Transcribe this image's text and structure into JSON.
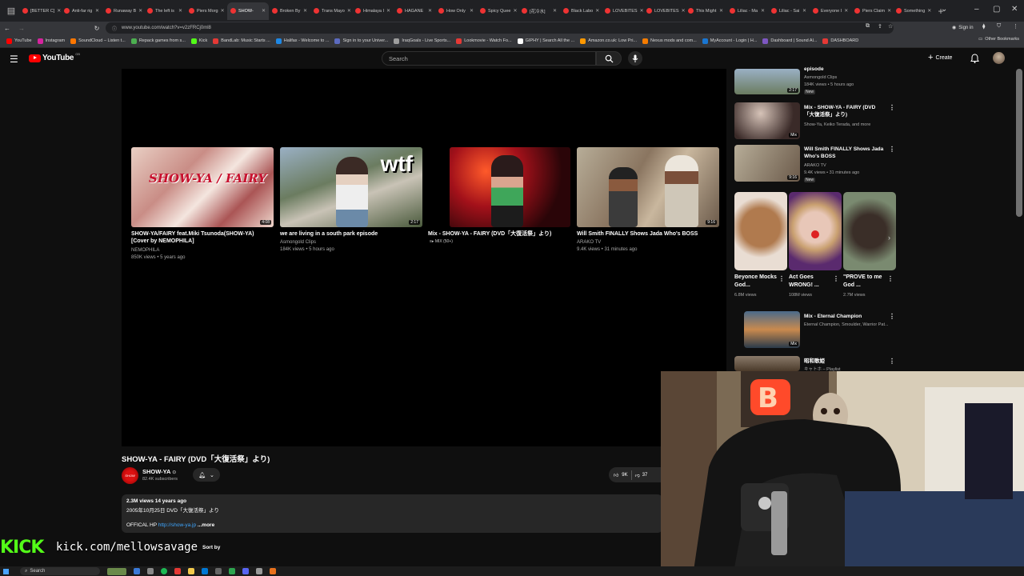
{
  "browser": {
    "tabs": [
      {
        "label": "[BETTER C]",
        "color": "#e33"
      },
      {
        "label": "Anti-far rig",
        "color": "#e33"
      },
      {
        "label": "Runaway B",
        "color": "#e33"
      },
      {
        "label": "The left is",
        "color": "#e33"
      },
      {
        "label": "Piers Morg",
        "color": "#e33"
      },
      {
        "label": "SHOW-",
        "color": "#e33",
        "active": true
      },
      {
        "label": "Broken By",
        "color": "#e33"
      },
      {
        "label": "Trans Mayo",
        "color": "#e33"
      },
      {
        "label": "Himalaya I",
        "color": "#e33"
      },
      {
        "label": "HAGANE",
        "color": "#e33"
      },
      {
        "label": "How Only",
        "color": "#e33"
      },
      {
        "label": "Spicy Quee",
        "color": "#e33"
      },
      {
        "label": "[花冷水]",
        "color": "#e33"
      },
      {
        "label": "Black Labo",
        "color": "#e33"
      },
      {
        "label": "LOVEBITES",
        "color": "#e33"
      },
      {
        "label": "LOVEBITES",
        "color": "#e33"
      },
      {
        "label": "This Might",
        "color": "#e33"
      },
      {
        "label": "Liliac - Ma",
        "color": "#e33"
      },
      {
        "label": "Liliac - Sai",
        "color": "#e33"
      },
      {
        "label": "Everyone I",
        "color": "#e33"
      },
      {
        "label": "Piers Claim",
        "color": "#e33"
      },
      {
        "label": "Something",
        "color": "#e33"
      }
    ],
    "new_tab": "+",
    "url": "www.youtube.com/watch?v=v2zFRCj0ml8",
    "sign_in": "Sign in",
    "bookmarks": [
      {
        "label": "YouTube",
        "color": "#ff0000"
      },
      {
        "label": "Instagram",
        "color": "#d6249f"
      },
      {
        "label": "SoundCloud – Listen t...",
        "color": "#ff7700"
      },
      {
        "label": "Repack games from s...",
        "color": "#4caf50"
      },
      {
        "label": "Kick",
        "color": "#53fc18"
      },
      {
        "label": "BandLab: Music Starts ...",
        "color": "#e53935"
      },
      {
        "label": "Halifax - Welcome to ...",
        "color": "#1e88e5"
      },
      {
        "label": "Sign in to your Univer...",
        "color": "#5c6bc0"
      },
      {
        "label": "IraqGoals - Live Sports...",
        "color": "#9e9e9e"
      },
      {
        "label": "Lookmovie - Watch Fo...",
        "color": "#e53935"
      },
      {
        "label": "GIPHY | Search All the ...",
        "color": "#ffffff"
      },
      {
        "label": "Amazon.co.uk: Low Pri...",
        "color": "#ff9900"
      },
      {
        "label": "Nexus mods and com...",
        "color": "#f57c00"
      },
      {
        "label": "MyAccount - Login | H...",
        "color": "#1976d2"
      },
      {
        "label": "Dashboard | Sound Al...",
        "color": "#7e57c2"
      },
      {
        "label": "DASHBOARD",
        "color": "#e53935"
      }
    ],
    "other_bookmarks": "Other Bookmarks"
  },
  "youtube": {
    "logo_text": "YouTube",
    "country": "GB",
    "search_placeholder": "Search",
    "create_label": "Create"
  },
  "endscreen": [
    {
      "title": "SHOW-YA/FAIRY feat.Miki Tsunoda(SHOW-YA)\n[Cover by NEMOPHILA]",
      "channel": "NEMOPHILA",
      "stats": "850K views • 5 years ago",
      "duration": "4:08",
      "thumb_text": "SHOW-YA / FAIRY"
    },
    {
      "title": "we are living in a south park episode",
      "channel": "Asmongold Clips",
      "stats": "184K views • 5 hours ago",
      "duration": "2:17",
      "thumb_text": "wtf"
    },
    {
      "title": "Mix - SHOW-YA - FAIRY (DVD「大復活祭」より)",
      "channel": "",
      "stats": "",
      "duration": "",
      "mix_badge": "MIX (50+)"
    },
    {
      "title": "Will Smith FINALLY Shows Jada Who's BOSS",
      "channel": "ARAKO TV",
      "stats": "9.4K views • 31 minutes ago",
      "duration": "9:16"
    }
  ],
  "video": {
    "title": "SHOW-YA - FAIRY (DVD「大復活祭」より)",
    "channel": "SHOW-YA",
    "verified": "⊙",
    "subscribers": "82.4K subscribers",
    "likes": "9K",
    "dislikes": "37",
    "desc_stats": "2.3M views  14 years ago",
    "desc_line2": "2005年10月25日 DVD「大復活祭」より",
    "desc_prefix": "OFFICAL HP ",
    "desc_link": "http://show-ya.jp",
    "desc_more": "...more",
    "sort_by": "Sort by"
  },
  "sidebar": {
    "recs": [
      {
        "title": "episode",
        "channel": "Asmongold Clips",
        "stats": "184K views • 5 hours ago",
        "badge": "New",
        "duration": "2:17"
      },
      {
        "title": "Mix - SHOW-YA - FAIRY (DVD「大復活祭」より)",
        "channel": "Show-Ya, Keiko Terada, and more",
        "stats": "",
        "badge": "",
        "duration": "Mix"
      },
      {
        "title": "Will Smith FINALLY Shows Jada Who's BOSS",
        "channel": "ARAKO TV",
        "stats": "9.4K views • 31 minutes ago",
        "badge": "New",
        "duration": "9:16"
      },
      {
        "title": "Mix - Eternal Champion",
        "channel": "Eternal Champion, Smoulder, Warrior Pat...",
        "stats": "",
        "badge": "",
        "duration": "Mix"
      },
      {
        "title": "昭和歌姫",
        "channel": "キャトホ – Playlist",
        "stats": "",
        "badge": "",
        "duration": ""
      }
    ],
    "shorts": [
      {
        "title": "Beyonce Mocks God...",
        "views": "6.8M views"
      },
      {
        "title": "Act Goes WRONG! ...",
        "views": "108M views"
      },
      {
        "title": "\"PROVE to me God ...",
        "views": "2.7M views"
      }
    ]
  },
  "overlay": {
    "kick_logo": "KICK",
    "kick_url": "kick.com/mellowsavage"
  },
  "taskbar": {
    "search_label": "Search"
  }
}
